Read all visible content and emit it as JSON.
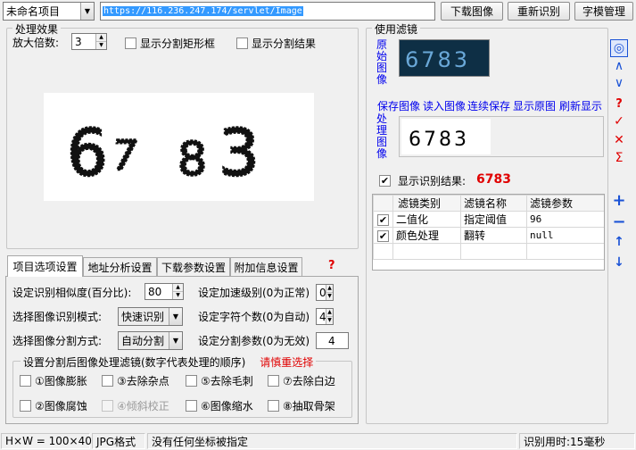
{
  "toolbar": {
    "project_select": "未命名项目",
    "url_value": "https://116.236.247.174/servlet/Image",
    "download_label": "下载图像",
    "reidentify_label": "重新识别",
    "charset_label": "字模管理"
  },
  "processing": {
    "group_label": "处理效果",
    "zoom_label": "放大倍数:",
    "zoom_value": "3",
    "show_rect_label": "显示分割矩形框",
    "show_result_label": "显示分割结果",
    "preview_digits": "6783"
  },
  "filters": {
    "group_label": "使用滤镜",
    "original_label": "原始图像",
    "processed_label": "处理图像",
    "original_digits": "6783",
    "processed_digits": "6783",
    "links": [
      "保存图像",
      "读入图像",
      "连续保存",
      "显示原图",
      "刷新显示"
    ],
    "show_result_label": "显示识别结果:",
    "result_value": "6783",
    "table": {
      "headers": [
        "滤镜类别",
        "滤镜名称",
        "滤镜参数"
      ],
      "rows": [
        {
          "checked": "✔",
          "category": "二值化",
          "name": "指定阈值",
          "param": "96"
        },
        {
          "checked": "✔",
          "category": "颜色处理",
          "name": "翻转",
          "param": "null"
        }
      ]
    },
    "side_buttons": {
      "circle": "◎",
      "up": "∧",
      "down": "∨",
      "help": "?",
      "check": "✓",
      "close": "✕",
      "sigma": "Σ",
      "add": "+",
      "remove": "−",
      "move_up": "↑",
      "move_down": "↓"
    },
    "colors": {
      "accent_red": "#e00000",
      "link_blue": "#0000ee",
      "tool_blue": "#1a52d6"
    }
  },
  "tabs": {
    "items": [
      "项目选项设置",
      "地址分析设置",
      "下载参数设置",
      "附加信息设置"
    ],
    "help": "?"
  },
  "options": {
    "similarity_label": "设定识别相似度(百分比):",
    "similarity_value": "80",
    "speed_label": "设定加速级别(0为正常)",
    "speed_value": "0",
    "mode_label": "选择图像识别模式:",
    "mode_value": "快速识别",
    "char_count_label": "设定字符个数(0为自动)",
    "char_count_value": "4",
    "split_label": "选择图像分割方式:",
    "split_value": "自动分割",
    "split_param_label": "设定分割参数(0为无效)",
    "split_param_value": "4",
    "filter_group_label": "设置分割后图像处理滤镜(数字代表处理的顺序)",
    "filter_group_hint": "请慎重选择",
    "filter_checks": [
      "①图像膨胀",
      "③去除杂点",
      "⑤去除毛刺",
      "⑦去除白边",
      "②图像腐蚀",
      "④倾斜校正",
      "⑥图像缩水",
      "⑧抽取骨架"
    ]
  },
  "status": {
    "size": "H×W = 100×40",
    "format": "JPG格式",
    "coords": "没有任何坐标被指定",
    "time": "识别用时:15毫秒"
  }
}
